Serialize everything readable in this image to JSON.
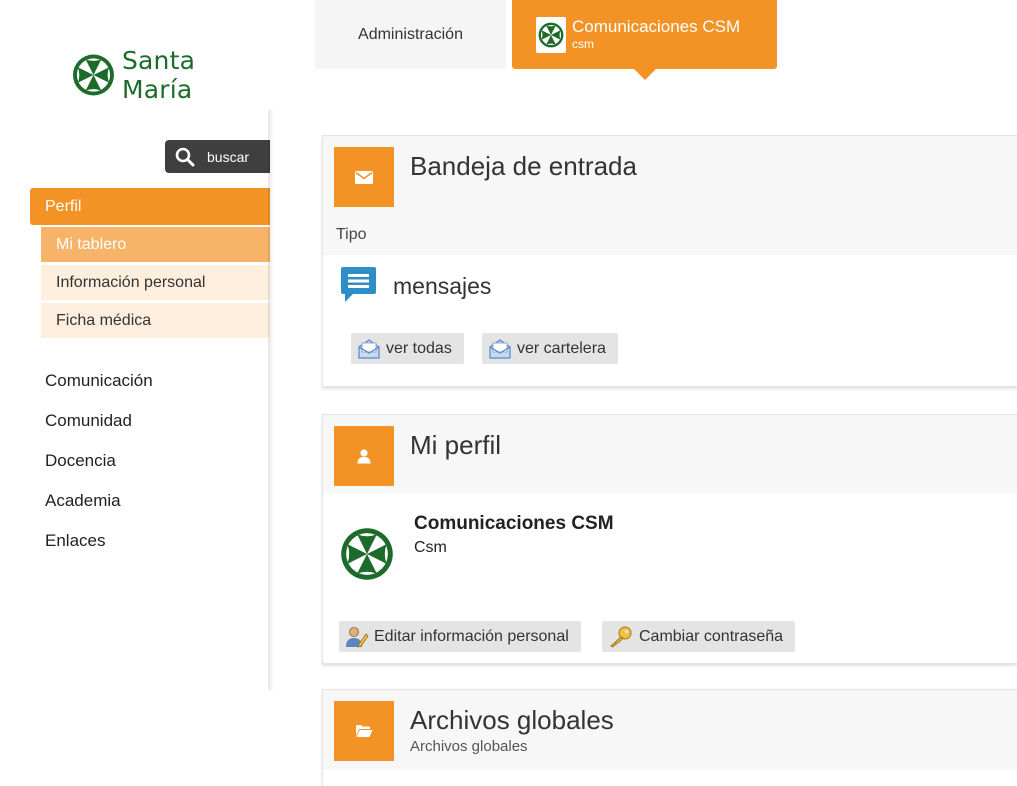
{
  "brand": {
    "name": "Santa María",
    "logo_icon": "green-cross-emblem-icon",
    "accent_color": "#f39325",
    "brand_green": "#1d6b2b"
  },
  "sidebar": {
    "search_label": "buscar",
    "section": "Perfil",
    "subitems": [
      {
        "label": "Mi tablero",
        "active": true
      },
      {
        "label": "Información personal",
        "active": false
      },
      {
        "label": "Ficha médica",
        "active": false
      }
    ],
    "items": [
      "Comunicación",
      "Comunidad",
      "Docencia",
      "Academia",
      "Enlaces"
    ]
  },
  "tabs": {
    "admin": "Administración",
    "active_title": "Comunicaciones CSM",
    "active_sub": "csm"
  },
  "inbox": {
    "title": "Bandeja de entrada",
    "tipo_label": "Tipo",
    "type_label": "mensajes",
    "buttons": {
      "all": "ver todas",
      "board": "ver cartelera"
    }
  },
  "profile": {
    "title": "Mi perfil",
    "name": "Comunicaciones CSM",
    "sub": "Csm",
    "buttons": {
      "edit": "Editar información personal",
      "password": "Cambiar contraseña"
    }
  },
  "files": {
    "title": "Archivos globales",
    "sub": "Archivos globales"
  }
}
